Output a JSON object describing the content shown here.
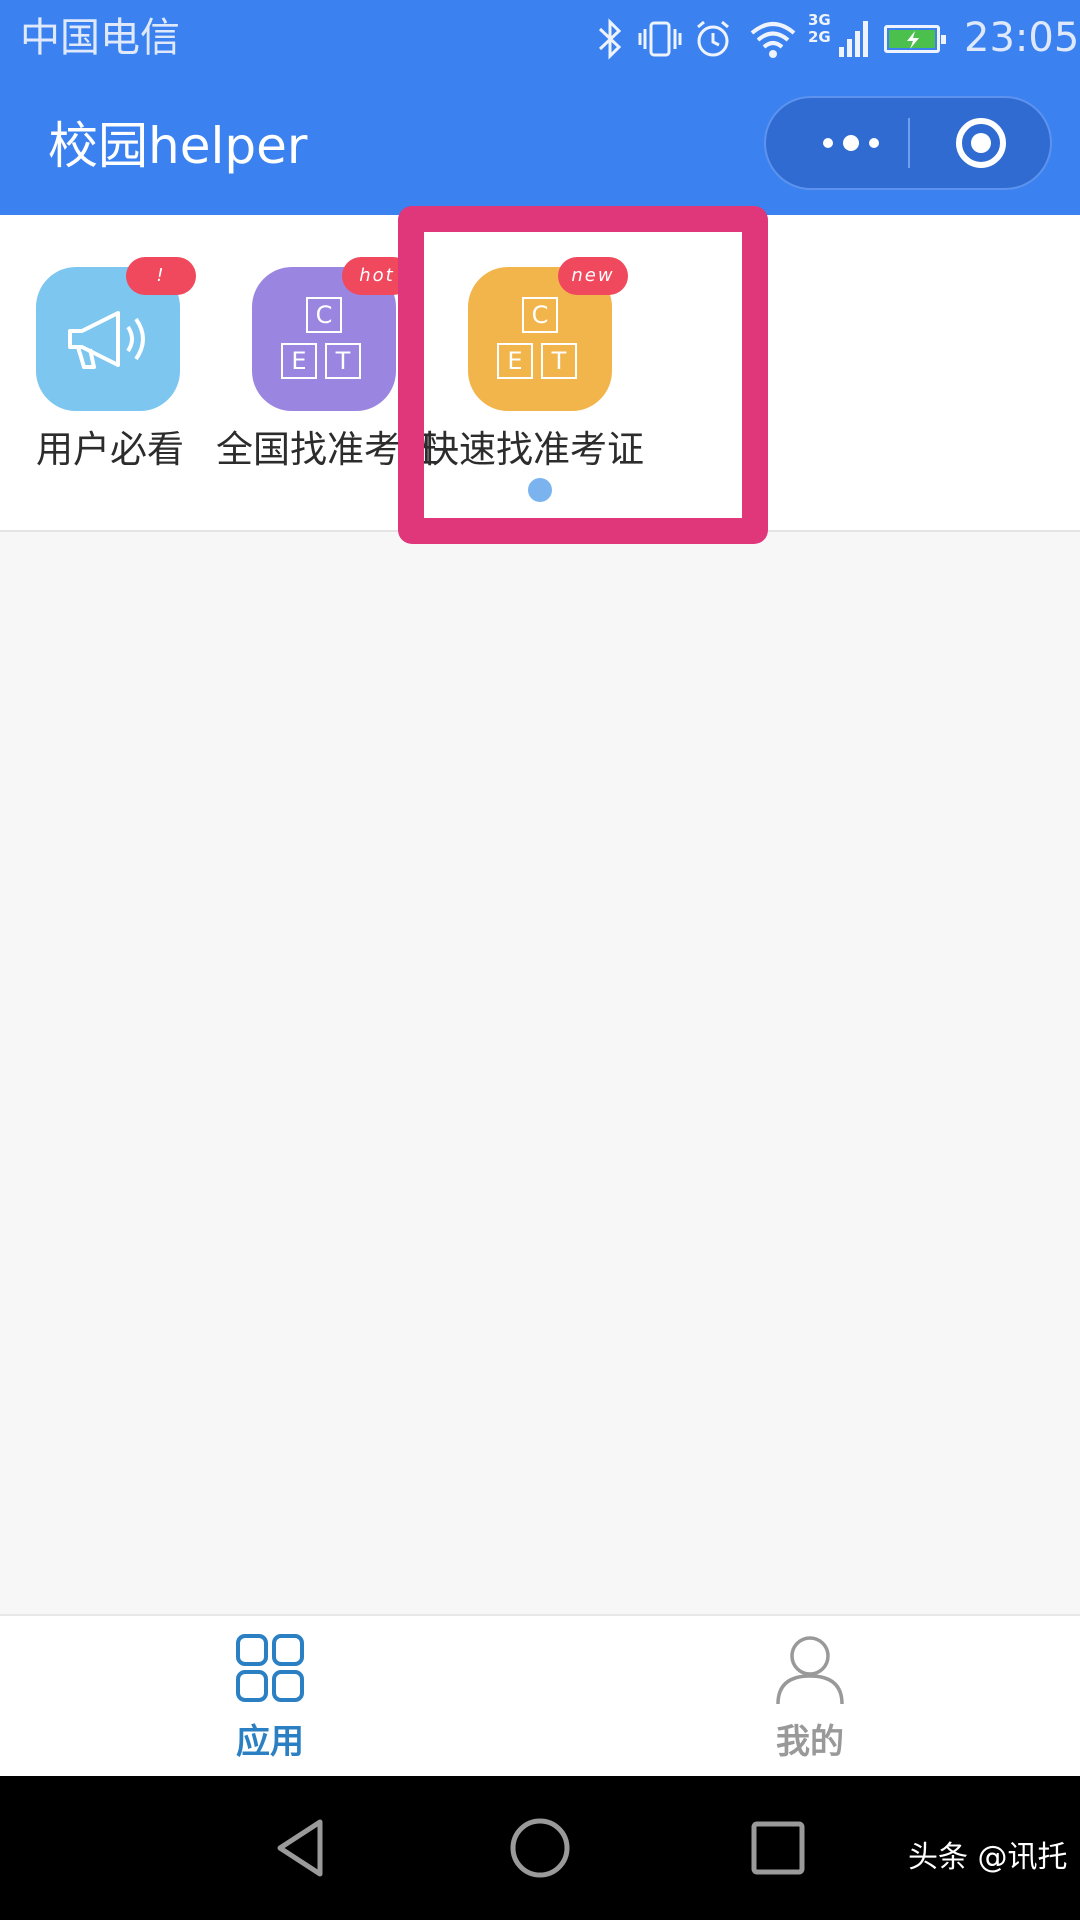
{
  "status_bar": {
    "carrier": "中国电信",
    "network_types": [
      "3G",
      "2G"
    ],
    "time": "23:05",
    "icons": [
      "bluetooth-icon",
      "vibrate-icon",
      "alarm-icon",
      "wifi-icon",
      "signal-icon",
      "battery-charging-icon"
    ]
  },
  "header": {
    "title": "校园helper",
    "capsule": {
      "more_icon": "more-dots-icon",
      "close_icon": "target-circle-icon"
    }
  },
  "apps": [
    {
      "label": "用户必看",
      "badge": "!",
      "icon": "megaphone-icon",
      "color": "#7cc6f0"
    },
    {
      "label": "全国找准考证",
      "badge": "hot",
      "icon": "cet-keys-icon",
      "color": "#9a86e0",
      "keys": [
        "C",
        "E",
        "T"
      ]
    },
    {
      "label": "快速找准考证",
      "badge": "new",
      "icon": "cet-keys-icon",
      "color": "#f2b54c",
      "keys": [
        "C",
        "E",
        "T"
      ]
    }
  ],
  "colors": {
    "header_bg": "#3b82f0",
    "highlight": "#e0367a",
    "badge": "#f0485c",
    "tab_active": "#2b7fc3",
    "tab_inactive": "#999999"
  },
  "tabbar": {
    "tabs": [
      {
        "label": "应用",
        "icon": "grid-apps-icon",
        "active": true
      },
      {
        "label": "我的",
        "icon": "user-profile-icon",
        "active": false
      }
    ]
  },
  "navbar": {
    "icons": [
      "back-triangle-icon",
      "home-circle-icon",
      "recent-square-icon"
    ]
  },
  "watermark": "头条 @讯托"
}
